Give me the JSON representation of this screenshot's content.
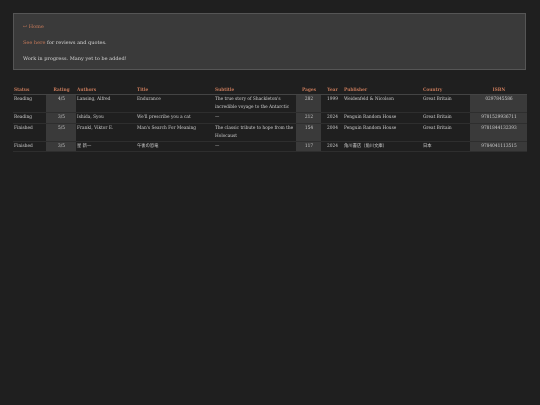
{
  "info": {
    "home_link": "↩ Home",
    "see_here_link": "See here",
    "see_here_rest": " for reviews and quotes.",
    "work_in_progress": "Work in progress. Many yet to be added!"
  },
  "table": {
    "headers": [
      "Status",
      "Rating",
      "Authors",
      "Title",
      "Subtitle",
      "Pages",
      "Year",
      "Publisher",
      "Country",
      "ISBN"
    ],
    "rows": [
      {
        "status": "Reading",
        "rating": "4/5",
        "authors": "Lansing, Alfred",
        "title": "Endurance",
        "subtitle": "The true story of Shackleton's incredible voyage to the Antarctic",
        "pages": "282",
        "year": "1999",
        "publisher": "Weidenfeld & Nicolson",
        "country": "Great Britain",
        "isbn": "0297845586"
      },
      {
        "status": "Reading",
        "rating": "3/5",
        "authors": "Ishida, Syou",
        "title": "We'll prescribe you a cat",
        "subtitle": "—",
        "pages": "212",
        "year": "2024",
        "publisher": "Penguin Random House",
        "country": "Great Britain",
        "isbn": "9781529936711"
      },
      {
        "status": "Finished",
        "rating": "5/5",
        "authors": "Frankl, Viktor E.",
        "title": "Man's Search For Meaning",
        "subtitle": "The classic tribute to hope from the Holocaust",
        "pages": "154",
        "year": "2004",
        "publisher": "Penguin Random House",
        "country": "Great Britain",
        "isbn": "9781844132393"
      },
      {
        "status": "Finished",
        "rating": "3/5",
        "authors": "星 新一",
        "title": "午後の恐竜",
        "subtitle": "—",
        "pages": "117",
        "year": "2024",
        "publisher": "角川書店（角川文庫）",
        "country": "日本",
        "isbn": "9784041113515"
      }
    ]
  }
}
